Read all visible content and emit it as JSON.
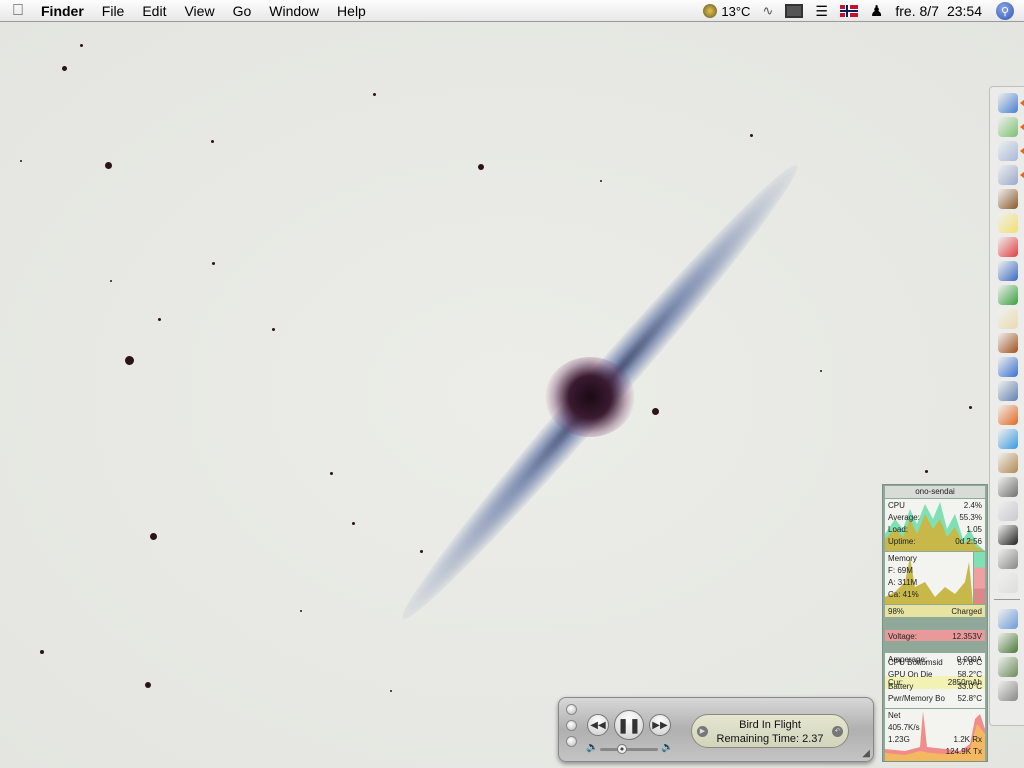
{
  "menubar": {
    "app": "Finder",
    "items": [
      "File",
      "Edit",
      "View",
      "Go",
      "Window",
      "Help"
    ],
    "temperature": "13°C",
    "date": "fre. 8/7",
    "time": "23:54"
  },
  "dock": {
    "icons": [
      "finder-icon",
      "itunes-icon",
      "safari-icon",
      "preview-icon",
      "chess-icon",
      "stickies-icon",
      "ical-icon",
      "quicksilver-icon",
      "net-icon",
      "textedit-icon",
      "iphoto-icon",
      "network-icon",
      "remote-desktop-icon",
      "firefox-icon",
      "ichat-icon",
      "address-book-icon",
      "sync-icon",
      "disk-utility-icon",
      "terminal-icon",
      "system-profiler-icon",
      "apple-icon",
      "applications-folder-icon",
      "downloads-folder-icon",
      "documents-icon",
      "trash-icon"
    ]
  },
  "monitor": {
    "title": "ono-sendai",
    "cpu": {
      "label": "CPU",
      "value": "2.4%",
      "avg_label": "Average:",
      "avg": "55.3%",
      "load_label": "Load:",
      "load": "1.05",
      "uptime_label": "Uptime:",
      "uptime": "0d 2:56"
    },
    "memory": {
      "label": "Memory",
      "f": "F: 69M",
      "a": "A: 311M",
      "ca": "Ca: 41%"
    },
    "battery": {
      "percent": "98%",
      "status": "Charged",
      "voltage_label": "Voltage:",
      "voltage": "12.353V",
      "amperage_label": "Amperage:",
      "amperage": "0.000A",
      "cur_label": "Cur:",
      "cur": "2850mAh"
    },
    "temps": [
      {
        "name": "CPU Bottomsid",
        "value": "57.8°C"
      },
      {
        "name": "GPU On Die",
        "value": "58.2°C"
      },
      {
        "name": "Battery",
        "value": "33.0°C"
      },
      {
        "name": "Pwr/Memory Bo",
        "value": "52.8°C"
      }
    ],
    "net": {
      "label": "Net",
      "rate": "405.7K/s",
      "total": "1.23G",
      "rx": "1.2K Rx",
      "tx": "124.9K Tx"
    }
  },
  "itunes": {
    "track": "Bird In Flight",
    "remaining": "Remaining Time: 2.37",
    "volume": 0.35
  },
  "colors": {
    "cpu_graph": "#c8b84a",
    "cpu_user": "#7fe0b4",
    "net_graph": "#f4b860",
    "net_peak": "#f08c8c",
    "voltage_bg": "#e89a9a",
    "cur_bg": "#f2f2b4"
  }
}
